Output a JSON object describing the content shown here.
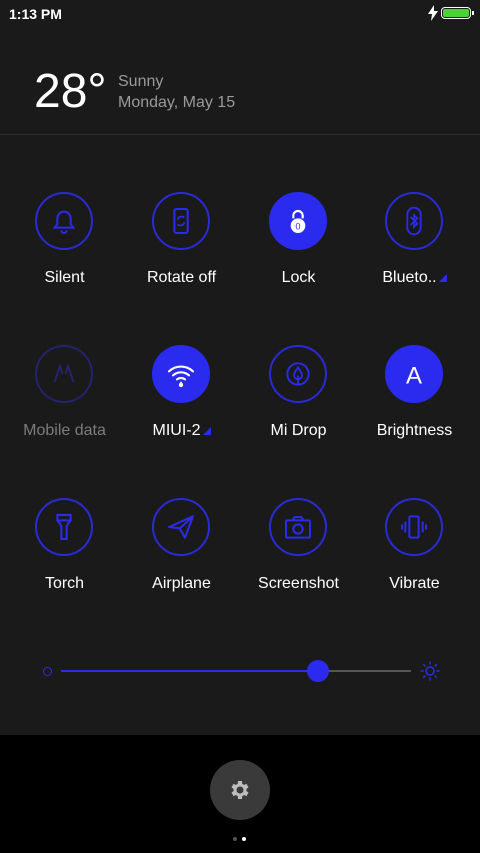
{
  "status": {
    "time": "1:13 PM",
    "battery_level": 1.0
  },
  "weather": {
    "temperature": "28°",
    "condition": "Sunny",
    "date": "Monday, May 15"
  },
  "tiles": [
    {
      "label": "Silent",
      "icon": "bell-icon",
      "state": "off"
    },
    {
      "label": "Rotate off",
      "icon": "rotate-icon",
      "state": "off"
    },
    {
      "label": "Lock",
      "icon": "lock-icon",
      "state": "on"
    },
    {
      "label": "Blueto..",
      "icon": "bluetooth-icon",
      "state": "off",
      "expand": true
    },
    {
      "label": "Mobile data",
      "icon": "mobile-data-icon",
      "state": "disabled"
    },
    {
      "label": "MIUI-2",
      "icon": "wifi-icon",
      "state": "on",
      "expand": true
    },
    {
      "label": "Mi Drop",
      "icon": "mi-drop-icon",
      "state": "off"
    },
    {
      "label": "Brightness",
      "icon": "auto-brightness-icon",
      "state": "on"
    },
    {
      "label": "Torch",
      "icon": "torch-icon",
      "state": "off"
    },
    {
      "label": "Airplane",
      "icon": "airplane-icon",
      "state": "off"
    },
    {
      "label": "Screenshot",
      "icon": "camera-icon",
      "state": "off"
    },
    {
      "label": "Vibrate",
      "icon": "vibrate-icon",
      "state": "off"
    }
  ],
  "brightness": {
    "level": 0.735
  },
  "pager": {
    "pages": 2,
    "current": 2
  },
  "colors": {
    "accent": "#2b2bf0",
    "panel": "#1a1a1a",
    "charging": "#4cd137"
  }
}
